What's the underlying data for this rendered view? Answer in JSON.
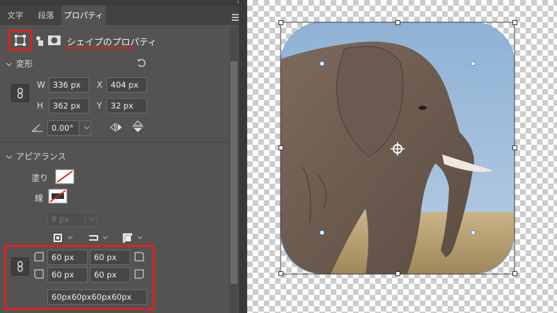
{
  "tabs": [
    "文字",
    "段落",
    "プロパティ"
  ],
  "collapse": "»",
  "header": {
    "title": "シェイプのプロパティ"
  },
  "transform": {
    "title": "変形",
    "w_label": "W",
    "w": "336 px",
    "h_label": "H",
    "h": "362 px",
    "x_label": "X",
    "x": "404 px",
    "y_label": "Y",
    "y": "32 px",
    "angle": "0.00°"
  },
  "appearance": {
    "title": "アピアランス",
    "fill_label": "塗り",
    "stroke_label": "線",
    "stroke_width": "8 px"
  },
  "corners": {
    "tl": "60 px",
    "tr": "60 px",
    "bl": "60 px",
    "br": "60 px",
    "combined": "60px60px60px60px"
  },
  "colors": {
    "highlight": "#e02020",
    "panel": "#535353",
    "handle_blue": "#3a8fe0"
  }
}
